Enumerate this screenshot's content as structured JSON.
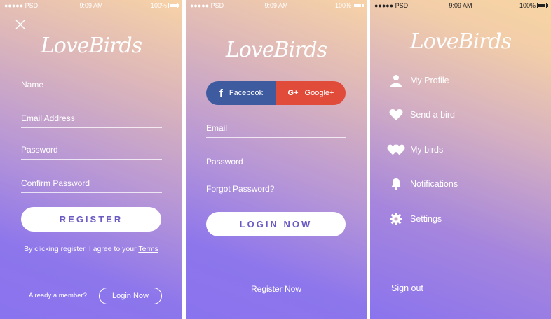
{
  "status_bar": {
    "carrier": "●●●●● PSD",
    "time": "9:09 AM",
    "battery": "100%"
  },
  "logo_text": "LoveBirds",
  "register_screen": {
    "fields": {
      "name": "Name",
      "email": "Email Address",
      "password": "Password",
      "confirm": "Confirm Password"
    },
    "register_button": "REGISTER",
    "terms_prefix": "By clicking register, I agree to your ",
    "terms_link": "Terms",
    "member_text": "Already a member?",
    "login_now_button": "Login Now"
  },
  "login_screen": {
    "facebook_label": "Facebook",
    "google_label": "Google+",
    "fields": {
      "email": "Email",
      "password": "Password"
    },
    "forgot_password": "Forgot Password?",
    "login_button": "LOGIN NOW",
    "register_link": "Register Now"
  },
  "menu_screen": {
    "items": [
      {
        "label": "My Profile",
        "icon": "user-icon"
      },
      {
        "label": "Send a bird",
        "icon": "heart-icon"
      },
      {
        "label": "My birds",
        "icon": "double-heart-icon"
      },
      {
        "label": "Notifications",
        "icon": "bell-icon"
      },
      {
        "label": "Settings",
        "icon": "gear-icon"
      }
    ],
    "sign_out": "Sign out"
  },
  "colors": {
    "accent_text": "#6c5ac4",
    "facebook": "#3f5ba0",
    "google": "#e04b3a",
    "gradient_top": "#f8d3a6",
    "gradient_bottom": "#8a73ee"
  }
}
